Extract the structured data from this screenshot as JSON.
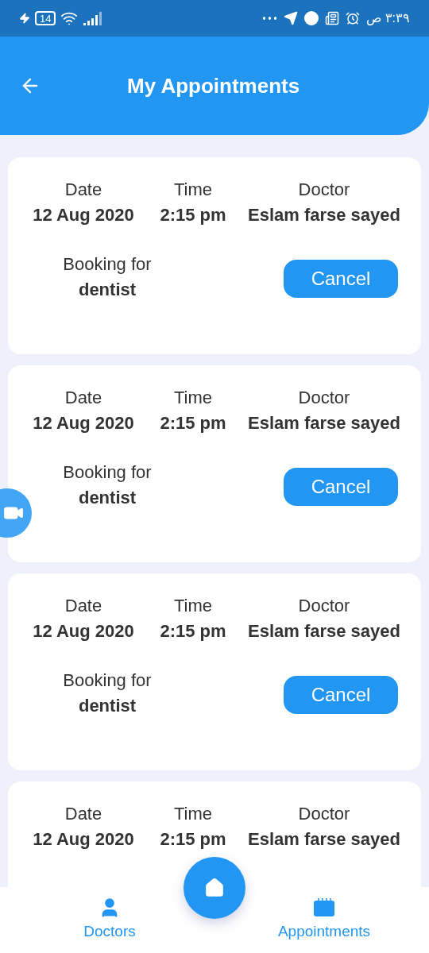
{
  "status_bar": {
    "battery": "14",
    "time": "٣:٣٩ ص"
  },
  "header": {
    "title": "My Appointments"
  },
  "appointments": [
    {
      "date_label": "Date",
      "date": "12 Aug 2020",
      "time_label": "Time",
      "time": "2:15 pm",
      "doctor_label": "Doctor",
      "doctor": "Eslam farse sayed",
      "booking_label": "Booking for",
      "booking": "dentist",
      "cancel": "Cancel"
    },
    {
      "date_label": "Date",
      "date": "12 Aug 2020",
      "time_label": "Time",
      "time": "2:15 pm",
      "doctor_label": "Doctor",
      "doctor": "Eslam farse sayed",
      "booking_label": "Booking for",
      "booking": "dentist",
      "cancel": "Cancel"
    },
    {
      "date_label": "Date",
      "date": "12 Aug 2020",
      "time_label": "Time",
      "time": "2:15 pm",
      "doctor_label": "Doctor",
      "doctor": "Eslam farse sayed",
      "booking_label": "Booking for",
      "booking": "dentist",
      "cancel": "Cancel"
    },
    {
      "date_label": "Date",
      "date": "12 Aug 2020",
      "time_label": "Time",
      "time": "2:15 pm",
      "doctor_label": "Doctor",
      "doctor": "Eslam farse sayed"
    }
  ],
  "bottom_nav": [
    {
      "kind": "doctors",
      "label": "Doctors"
    },
    {
      "kind": "appointments",
      "label": "Appointments"
    }
  ]
}
